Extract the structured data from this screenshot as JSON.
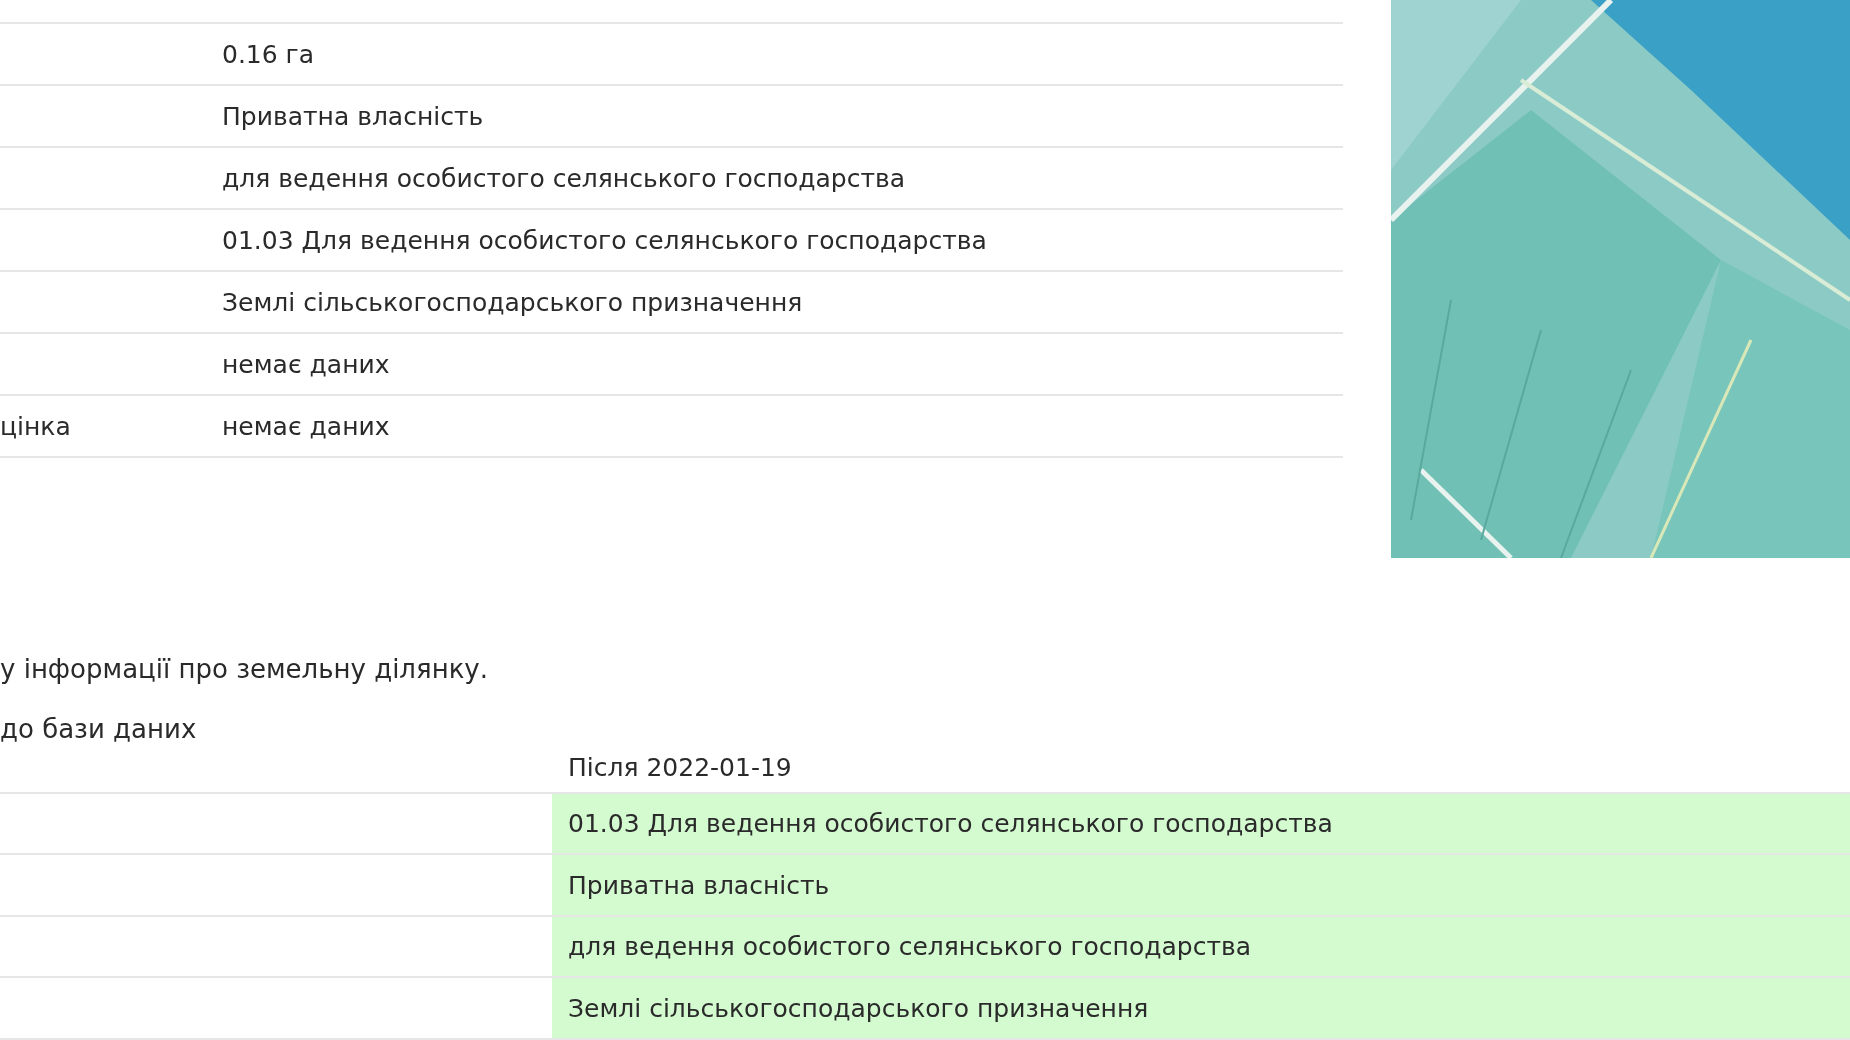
{
  "parcel_table": {
    "rows": [
      {
        "label": "",
        "value": "0.16 га"
      },
      {
        "label": "",
        "value": "Приватна власність"
      },
      {
        "label": "",
        "value": "для ведення особистого селянського господарства"
      },
      {
        "label": "",
        "value": "01.03 Для ведення особистого селянського господарства"
      },
      {
        "label": "",
        "value": "Землі сільськогосподарського призначення"
      },
      {
        "label": "",
        "value": "немає даних"
      },
      {
        "label": "цінка",
        "value": "немає даних"
      }
    ]
  },
  "notice": "у інформації про земельну ділянку.",
  "changes_title": "до бази даних",
  "changes_table": {
    "column_header": "Після 2022-01-19",
    "rows": [
      {
        "value": "01.03 Для ведення особистого селянського господарства",
        "changed": true
      },
      {
        "value": "Приватна власність",
        "changed": true
      },
      {
        "value": "для ведення особистого селянського господарства",
        "changed": true
      },
      {
        "value": "Землі сільськогосподарського призначення",
        "changed": true
      }
    ]
  }
}
